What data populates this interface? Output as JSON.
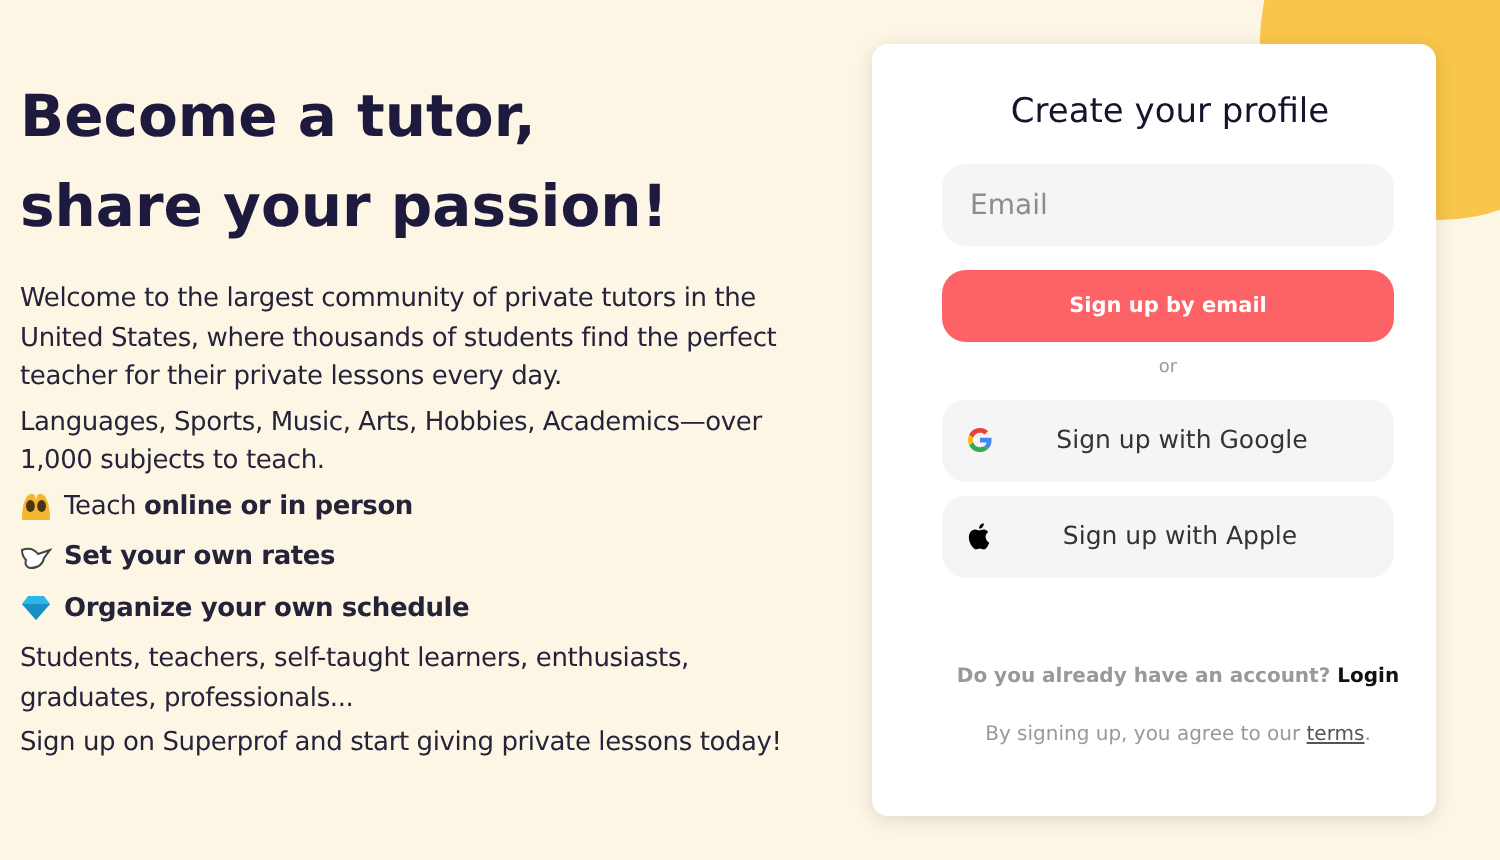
{
  "hero": {
    "title_lines": [
      "Become a tutor,",
      "share your passion!"
    ],
    "paragraphs_top": [
      "Welcome to the largest community of private tutors in the United States, where thousands of students find the perfect teacher for their private lessons every day.",
      "Languages, Sports, Music, Arts, Hobbies, Academics—over 1,000 subjects to teach."
    ],
    "features": [
      {
        "text": "Teach **online or in person**",
        "bold": false
      },
      {
        "text": "Set your own rates",
        "bold": true
      },
      {
        "text": "Organize your own schedule",
        "bold": true
      }
    ],
    "paragraphs_bottom": [
      "Students, teachers, self-taught learners, enthusiasts, graduates, professionals...",
      "Sign up on Superprof and start giving private lessons today!"
    ]
  },
  "signup_card": {
    "title": "Create your profile",
    "email_field": {
      "placeholder": "Email"
    },
    "email_button": "Sign up by email",
    "divider": "or",
    "social_buttons": [
      {
        "kind": "google",
        "label": "Sign up with Google"
      },
      {
        "kind": "apple",
        "label": "Sign up with Apple"
      }
    ],
    "login_prompt": {
      "text": "Do you already have an account?",
      "link": "Login"
    },
    "terms_note": {
      "text_before": "By signing up, you agree to our",
      "link": "terms",
      "text_after": "."
    }
  }
}
